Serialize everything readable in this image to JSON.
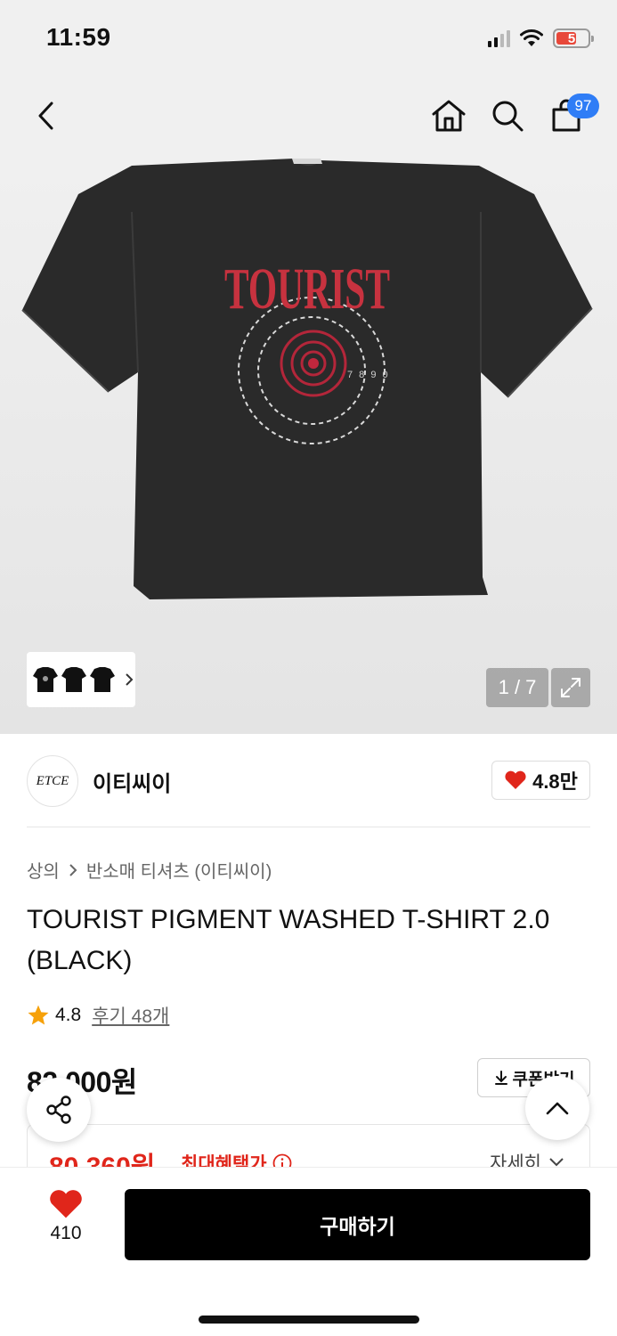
{
  "status_bar": {
    "time": "11:59",
    "battery": "5"
  },
  "header": {
    "back_icon": "chevron-left-icon",
    "home_icon": "home-icon",
    "search_icon": "search-icon",
    "cart_icon": "shopping-bag-icon",
    "cart_count": "97"
  },
  "gallery": {
    "counter": "1 / 7",
    "shirt_print_text": "TOURIST",
    "target_digits": "7 8 9 0",
    "expand_icon": "expand-icon"
  },
  "brand": {
    "logo_text": "ETCE",
    "name": "이티씨이",
    "likes": "4.8만"
  },
  "product": {
    "breadcrumb": [
      "상의",
      "반소매 티셔츠 (이티씨이)"
    ],
    "title": "TOURIST PIGMENT WASHED T-SHIRT 2.0 (BLACK)",
    "rating": "4.8",
    "reviews": "후기 48개",
    "price": "82,000원",
    "coupon_label": "쿠폰받기",
    "sale_price": "80,360원",
    "max_benefit_label": "최대혜택가",
    "detail_label": "자세히"
  },
  "bottom_bar": {
    "wish_count": "410",
    "buy_label": "구매하기"
  },
  "colors": {
    "accent_red": "#e0261b",
    "badge_blue": "#2f7df6",
    "buy_button": "#000000"
  }
}
